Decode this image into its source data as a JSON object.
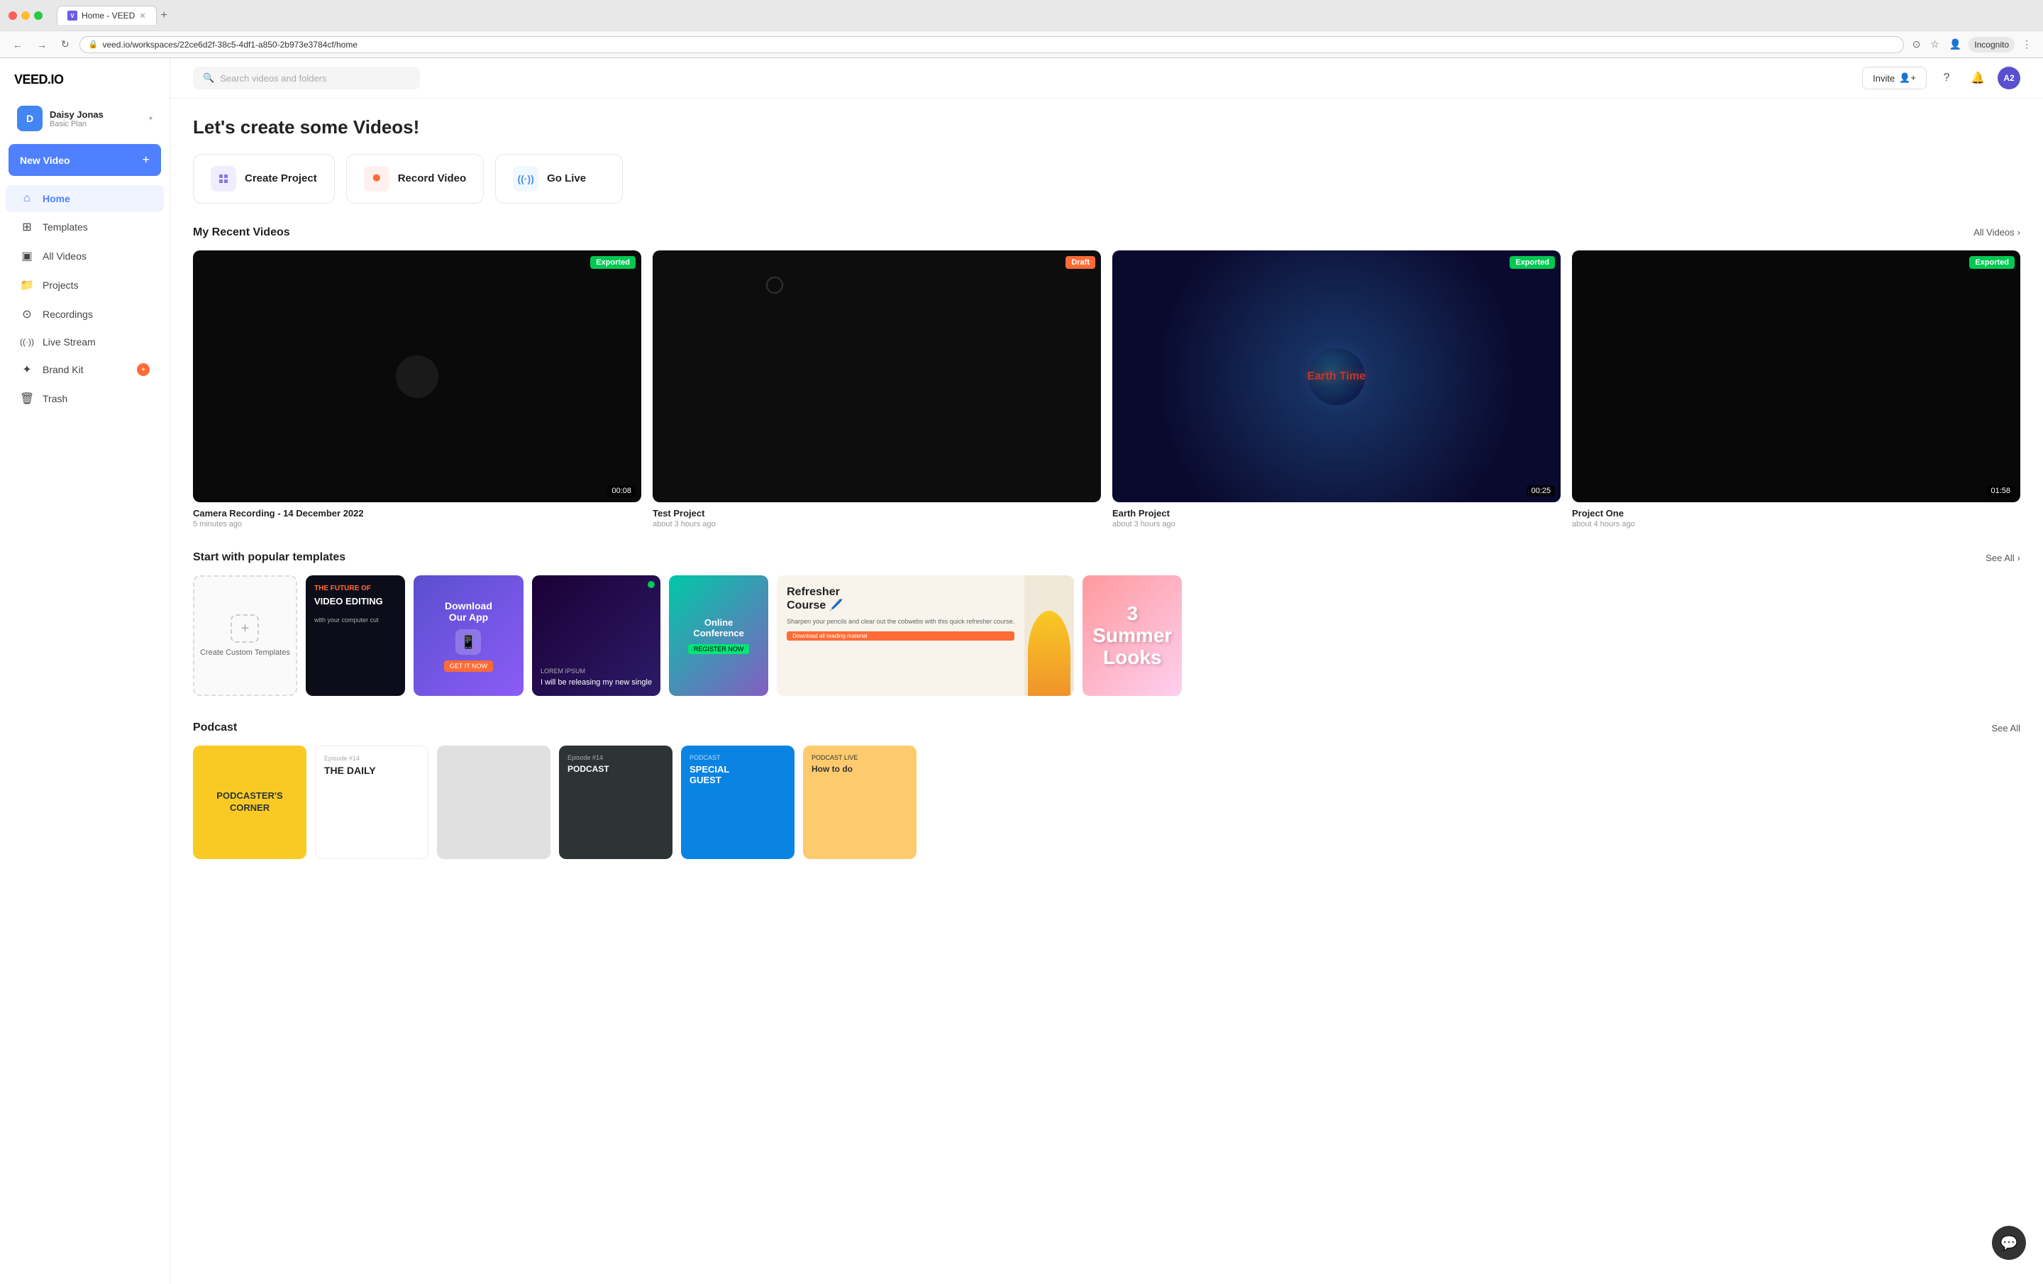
{
  "browser": {
    "tab_title": "Home - VEED",
    "tab_favicon": "V",
    "url": "veed.io/workspaces/22ce6d2f-38c5-4df1-a850-2b973e3784cf/home",
    "nav_back": "←",
    "nav_forward": "→",
    "nav_refresh": "↻",
    "incognito_label": "Incognito"
  },
  "sidebar": {
    "logo": "VEED.IO",
    "user": {
      "initial": "D",
      "name": "Daisy Jonas",
      "plan": "Basic Plan"
    },
    "new_video_btn": "New Video",
    "nav_items": [
      {
        "id": "home",
        "label": "Home",
        "icon": "⌂",
        "active": true
      },
      {
        "id": "templates",
        "label": "Templates",
        "icon": "⊞"
      },
      {
        "id": "all-videos",
        "label": "All Videos",
        "icon": "▣"
      },
      {
        "id": "projects",
        "label": "Projects",
        "icon": "📁"
      },
      {
        "id": "recordings",
        "label": "Recordings",
        "icon": "⊙"
      },
      {
        "id": "live-stream",
        "label": "Live Stream",
        "icon": "((·))"
      },
      {
        "id": "brand-kit",
        "label": "Brand Kit",
        "icon": "✦",
        "badge": "+"
      },
      {
        "id": "trash",
        "label": "Trash",
        "icon": "🗑"
      }
    ]
  },
  "header": {
    "search_placeholder": "Search videos and folders",
    "invite_label": "Invite",
    "user_initial": "A2"
  },
  "main": {
    "hero_title_prefix": "Let's create some ",
    "hero_title_highlight": "Videos!",
    "action_cards": [
      {
        "id": "create-project",
        "label": "Create Project",
        "icon": "✦",
        "icon_class": "icon-create"
      },
      {
        "id": "record-video",
        "label": "Record Video",
        "icon": "⏺",
        "icon_class": "icon-record"
      },
      {
        "id": "go-live",
        "label": "Go Live",
        "icon": "((·))",
        "icon_class": "icon-live"
      }
    ],
    "recent_videos_title": "My Recent Videos",
    "all_videos_link": "All Videos",
    "videos": [
      {
        "id": "vid1",
        "title": "Camera Recording - 14 December 2022",
        "time": "5 minutes ago",
        "duration": "00:08",
        "badge": "Exported",
        "badge_class": "badge-exported",
        "thumb_type": "dark-circle"
      },
      {
        "id": "vid2",
        "title": "Test Project",
        "time": "about 3 hours ago",
        "duration": null,
        "badge": "Draft",
        "badge_class": "badge-draft",
        "thumb_type": "dark"
      },
      {
        "id": "vid3",
        "title": "Earth Project",
        "time": "about 3 hours ago",
        "duration": "00:25",
        "badge": "Exported",
        "badge_class": "badge-exported",
        "thumb_type": "earth"
      },
      {
        "id": "vid4",
        "title": "Project One",
        "time": "about 4 hours ago",
        "duration": "01:58",
        "badge": "Exported",
        "badge_class": "badge-exported",
        "thumb_type": "dark"
      }
    ],
    "templates_title": "Start with popular templates",
    "templates_see_all": "See All",
    "templates": [
      {
        "id": "create-custom",
        "type": "create",
        "label": "Create Custom Templates"
      },
      {
        "id": "tmpl1",
        "type": "dark-video",
        "label": "The Future of Video Editing"
      },
      {
        "id": "tmpl2",
        "type": "download-app",
        "label": "Download Our App"
      },
      {
        "id": "tmpl3",
        "type": "dark-event",
        "label": "Lorem Ipsum"
      },
      {
        "id": "tmpl4",
        "type": "conference",
        "label": "Online Conference",
        "has_dot": true
      },
      {
        "id": "tmpl5",
        "type": "refresher",
        "label": "Refresher Course"
      },
      {
        "id": "tmpl6",
        "type": "summer",
        "label": "3 Summer Looks"
      }
    ],
    "podcast_title": "Podcast",
    "podcast_see_all": "See All",
    "podcasts": [
      {
        "id": "pod1",
        "type": "pod-yellow",
        "label": "Podcaster's Corner"
      },
      {
        "id": "pod2",
        "type": "pod-white",
        "label": "The Daily"
      },
      {
        "id": "pod3",
        "type": "pod-gray",
        "label": ""
      },
      {
        "id": "pod4",
        "type": "pod-dark",
        "label": "Episode #14"
      },
      {
        "id": "pod5",
        "type": "pod-blue",
        "label": "Special Guest"
      },
      {
        "id": "pod6",
        "type": "pod-yellow2",
        "label": "Podcast Live"
      }
    ]
  },
  "chat": {
    "icon": "💬"
  }
}
